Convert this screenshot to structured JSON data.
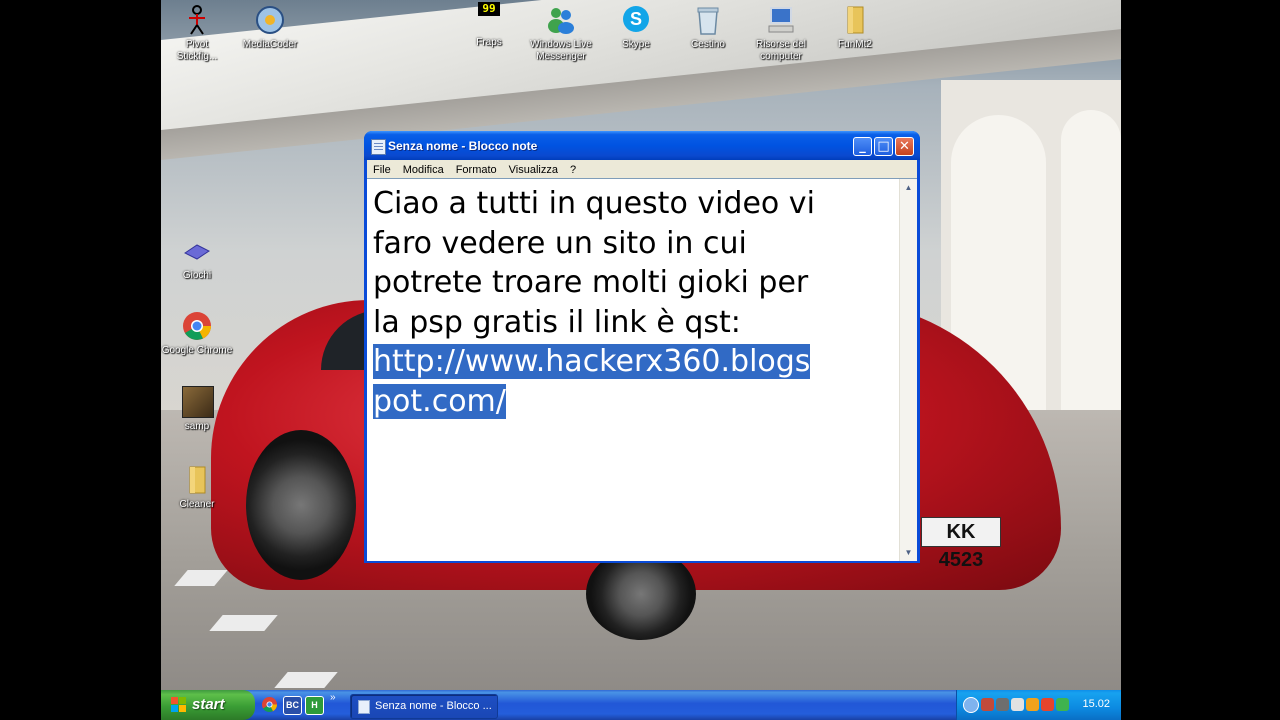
{
  "desktop": {
    "icons": [
      {
        "label": "Pivot\nStickfig..."
      },
      {
        "label": "MediaCoder"
      },
      {
        "label": "Fraps"
      },
      {
        "label": "Windows Live\nMessenger"
      },
      {
        "label": "Skype"
      },
      {
        "label": "Cestino"
      },
      {
        "label": "Risorse del\ncomputer"
      },
      {
        "label": "FunMt2"
      },
      {
        "label": "Giochi"
      },
      {
        "label": "Google Chrome"
      },
      {
        "label": "samp"
      },
      {
        "label": "Cleaner"
      }
    ],
    "fraps_badge": "99",
    "plate": "KK 4523"
  },
  "notepad": {
    "title": "Senza nome - Blocco note",
    "menu": [
      "File",
      "Modifica",
      "Formato",
      "Visualizza",
      "?"
    ],
    "text_plain": "Ciao a tutti in questo video vi\nfaro vedere un sito in cui\npotrete troare molti gioki per\nla psp gratis il link è qst:\n",
    "text_selected": "http://www.hackerx360.blogs\npot.com/",
    "buttons": {
      "minimize": "_",
      "maximize": "□",
      "close": "✕"
    }
  },
  "taskbar": {
    "start_label": "start",
    "quick_launch": [
      "chrome-icon",
      "BC",
      "H"
    ],
    "task_button": "Senza nome - Blocco ...",
    "clock": "15.02"
  },
  "colors": {
    "titlebar": "#0053e1",
    "selection": "#316ac5",
    "start": "#3a9d35",
    "tray": "#0c8ae1"
  }
}
